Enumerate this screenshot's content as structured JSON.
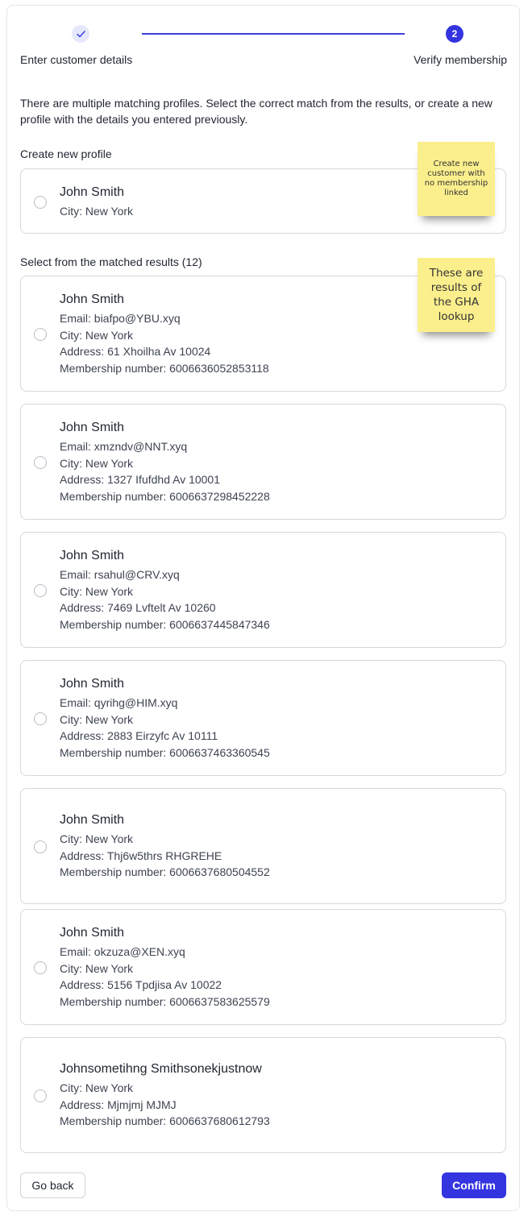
{
  "stepper": {
    "step1": {
      "icon": "checkmark-icon",
      "label": "Enter customer details"
    },
    "step2": {
      "number": "2",
      "label": "Verify membership"
    }
  },
  "intro": "There are multiple matching profiles. Select the correct match from the results, or create a new profile with the details you entered previously.",
  "create_section": {
    "label": "Create new profile",
    "card": {
      "name": "John Smith",
      "city": "City: New York"
    }
  },
  "matched_section": {
    "label": "Select from the matched results (12)",
    "results": [
      {
        "name": "John Smith",
        "email": "Email: biafpo@YBU.xyq",
        "city": "City: New York",
        "address": "Address: 61 Xhoilha Av 10024",
        "membership": "Membership number: 6006636052853118"
      },
      {
        "name": "John Smith",
        "email": "Email: xmzndv@NNT.xyq",
        "city": "City: New York",
        "address": "Address: 1327 Ifufdhd Av 10001",
        "membership": "Membership number: 6006637298452228"
      },
      {
        "name": "John Smith",
        "email": "Email: rsahul@CRV.xyq",
        "city": "City: New York",
        "address": "Address: 7469 Lvftelt Av 10260",
        "membership": "Membership number: 6006637445847346"
      },
      {
        "name": "John Smith",
        "email": "Email: qyrihg@HIM.xyq",
        "city": "City: New York",
        "address": "Address: 2883 Eirzyfc Av 10111",
        "membership": "Membership number: 6006637463360545"
      },
      {
        "name": "John Smith",
        "city": "City: New York",
        "address": "Address: Thj6w5thrs RHGREHE",
        "membership": "Membership number: 6006637680504552"
      },
      {
        "name": "John Smith",
        "email": "Email: okzuza@XEN.xyq",
        "city": "City: New York",
        "address": "Address: 5156 Tpdjisa Av 10022",
        "membership": "Membership number: 6006637583625579"
      },
      {
        "name": "Johnsometihng Smithsonekjustnow",
        "city": "City: New York",
        "address": "Address: Mjmjmj MJMJ",
        "membership": "Membership number: 6006637680612793"
      }
    ]
  },
  "sticky_notes": {
    "note1": "Create new customer with no membership linked",
    "note2": "These are results of the GHA lookup"
  },
  "footer": {
    "back_label": "Go back",
    "confirm_label": "Confirm"
  },
  "colors": {
    "accent": "#3434e0",
    "sticky": "#fbef8d"
  }
}
